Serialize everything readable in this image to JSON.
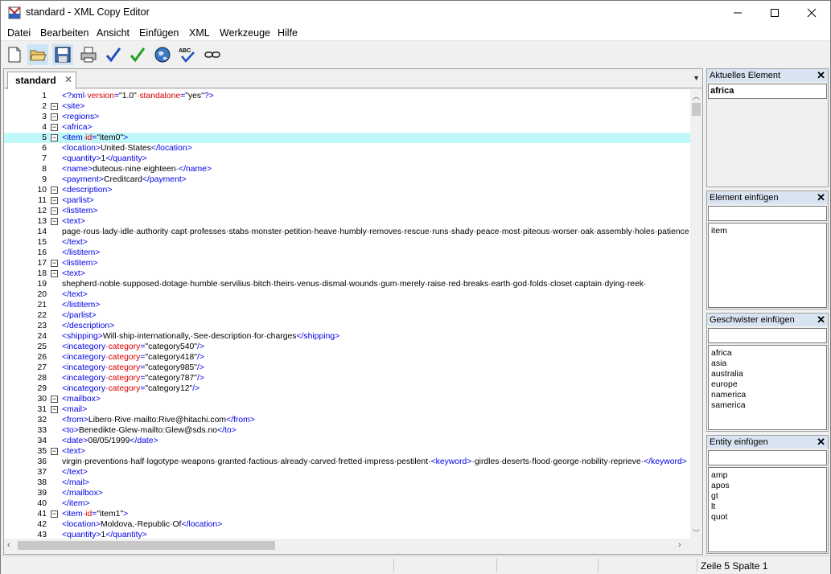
{
  "window": {
    "title": "standard - XML Copy Editor",
    "minimize_icon": "minimize-icon",
    "maximize_icon": "maximize-icon",
    "close_icon": "close-icon"
  },
  "menu": [
    "Datei",
    "Bearbeiten",
    "Ansicht",
    "Einfügen",
    "XML",
    "Werkzeuge",
    "Hilfe"
  ],
  "toolbar": [
    "new-file-icon",
    "open-folder-icon",
    "save-icon",
    "print-icon",
    "check-wellformed-icon",
    "validate-icon",
    "browser-icon",
    "spellcheck-icon",
    "link-icon"
  ],
  "tab": {
    "label": "standard",
    "close": "✕"
  },
  "editor": {
    "current_line": 5,
    "lines": [
      {
        "n": "1",
        "fold": false,
        "parts": [
          [
            "tag",
            "<?xml·"
          ],
          [
            "attr",
            "version"
          ],
          [
            "tag",
            "="
          ],
          [
            "txt",
            "\"1.0\""
          ],
          [
            "attr",
            "·standalone"
          ],
          [
            "tag",
            "="
          ],
          [
            "txt",
            "\"yes\""
          ],
          [
            "tag",
            "?>"
          ]
        ]
      },
      {
        "n": "2",
        "fold": true,
        "parts": [
          [
            "tag",
            "<site>"
          ]
        ]
      },
      {
        "n": "3",
        "fold": true,
        "parts": [
          [
            "tag",
            "<regions>"
          ]
        ]
      },
      {
        "n": "4",
        "fold": true,
        "parts": [
          [
            "tag",
            "<africa>"
          ]
        ]
      },
      {
        "n": "5",
        "fold": true,
        "parts": [
          [
            "tag",
            "<item"
          ],
          [
            "attr",
            "·id"
          ],
          [
            "tag",
            "="
          ],
          [
            "txt",
            "\"item0\""
          ],
          [
            "tag",
            ">"
          ]
        ]
      },
      {
        "n": "6",
        "fold": false,
        "parts": [
          [
            "tag",
            "<location>"
          ],
          [
            "txt",
            "United·States"
          ],
          [
            "tag",
            "</location>"
          ]
        ]
      },
      {
        "n": "7",
        "fold": false,
        "parts": [
          [
            "tag",
            "<quantity>"
          ],
          [
            "txt",
            "1"
          ],
          [
            "tag",
            "</quantity>"
          ]
        ]
      },
      {
        "n": "8",
        "fold": false,
        "parts": [
          [
            "tag",
            "<name>"
          ],
          [
            "txt",
            "duteous·nine·eighteen·"
          ],
          [
            "tag",
            "</name>"
          ]
        ]
      },
      {
        "n": "9",
        "fold": false,
        "parts": [
          [
            "tag",
            "<payment>"
          ],
          [
            "txt",
            "Creditcard"
          ],
          [
            "tag",
            "</payment>"
          ]
        ]
      },
      {
        "n": "10",
        "fold": true,
        "parts": [
          [
            "tag",
            "<description>"
          ]
        ]
      },
      {
        "n": "11",
        "fold": true,
        "parts": [
          [
            "tag",
            "<parlist>"
          ]
        ]
      },
      {
        "n": "12",
        "fold": true,
        "parts": [
          [
            "tag",
            "<listitem>"
          ]
        ]
      },
      {
        "n": "13",
        "fold": true,
        "parts": [
          [
            "tag",
            "<text>"
          ]
        ]
      },
      {
        "n": "14",
        "fold": false,
        "parts": [
          [
            "txt",
            "page·rous·lady·idle·authority·capt·professes·stabs·monster·petition·heave·humbly·removes·rescue·runs·shady·peace·most·piteous·worser·oak·assembly·holes·patience"
          ]
        ]
      },
      {
        "n": "15",
        "fold": false,
        "parts": [
          [
            "tag",
            "</text>"
          ]
        ]
      },
      {
        "n": "16",
        "fold": false,
        "parts": [
          [
            "tag",
            "</listitem>"
          ]
        ]
      },
      {
        "n": "17",
        "fold": true,
        "parts": [
          [
            "tag",
            "<listitem>"
          ]
        ]
      },
      {
        "n": "18",
        "fold": true,
        "parts": [
          [
            "tag",
            "<text>"
          ]
        ]
      },
      {
        "n": "19",
        "fold": false,
        "parts": [
          [
            "txt",
            "shepherd·noble·supposed·dotage·humble·servilius·bitch·theirs·venus·dismal·wounds·gum·merely·raise·red·breaks·earth·god·folds·closet·captain·dying·reek·"
          ]
        ]
      },
      {
        "n": "20",
        "fold": false,
        "parts": [
          [
            "tag",
            "</text>"
          ]
        ]
      },
      {
        "n": "21",
        "fold": false,
        "parts": [
          [
            "tag",
            "</listitem>"
          ]
        ]
      },
      {
        "n": "22",
        "fold": false,
        "parts": [
          [
            "tag",
            "</parlist>"
          ]
        ]
      },
      {
        "n": "23",
        "fold": false,
        "parts": [
          [
            "tag",
            "</description>"
          ]
        ]
      },
      {
        "n": "24",
        "fold": false,
        "parts": [
          [
            "tag",
            "<shipping>"
          ],
          [
            "txt",
            "Will·ship·internationally,·See·description·for·charges"
          ],
          [
            "tag",
            "</shipping>"
          ]
        ]
      },
      {
        "n": "25",
        "fold": false,
        "parts": [
          [
            "tag",
            "<incategory"
          ],
          [
            "attr",
            "·category"
          ],
          [
            "tag",
            "="
          ],
          [
            "txt",
            "\"category540\""
          ],
          [
            "tag",
            "/>"
          ]
        ]
      },
      {
        "n": "26",
        "fold": false,
        "parts": [
          [
            "tag",
            "<incategory"
          ],
          [
            "attr",
            "·category"
          ],
          [
            "tag",
            "="
          ],
          [
            "txt",
            "\"category418\""
          ],
          [
            "tag",
            "/>"
          ]
        ]
      },
      {
        "n": "27",
        "fold": false,
        "parts": [
          [
            "tag",
            "<incategory"
          ],
          [
            "attr",
            "·category"
          ],
          [
            "tag",
            "="
          ],
          [
            "txt",
            "\"category985\""
          ],
          [
            "tag",
            "/>"
          ]
        ]
      },
      {
        "n": "28",
        "fold": false,
        "parts": [
          [
            "tag",
            "<incategory"
          ],
          [
            "attr",
            "·category"
          ],
          [
            "tag",
            "="
          ],
          [
            "txt",
            "\"category787\""
          ],
          [
            "tag",
            "/>"
          ]
        ]
      },
      {
        "n": "29",
        "fold": false,
        "parts": [
          [
            "tag",
            "<incategory"
          ],
          [
            "attr",
            "·category"
          ],
          [
            "tag",
            "="
          ],
          [
            "txt",
            "\"category12\""
          ],
          [
            "tag",
            "/>"
          ]
        ]
      },
      {
        "n": "30",
        "fold": true,
        "parts": [
          [
            "tag",
            "<mailbox>"
          ]
        ]
      },
      {
        "n": "31",
        "fold": true,
        "parts": [
          [
            "tag",
            "<mail>"
          ]
        ]
      },
      {
        "n": "32",
        "fold": false,
        "parts": [
          [
            "tag",
            "<from>"
          ],
          [
            "txt",
            "Libero·Rive·mailto:Rive@hitachi.com"
          ],
          [
            "tag",
            "</from>"
          ]
        ]
      },
      {
        "n": "33",
        "fold": false,
        "parts": [
          [
            "tag",
            "<to>"
          ],
          [
            "txt",
            "Benedikte·Glew·mailto:Glew@sds.no"
          ],
          [
            "tag",
            "</to>"
          ]
        ]
      },
      {
        "n": "34",
        "fold": false,
        "parts": [
          [
            "tag",
            "<date>"
          ],
          [
            "txt",
            "08/05/1999"
          ],
          [
            "tag",
            "</date>"
          ]
        ]
      },
      {
        "n": "35",
        "fold": true,
        "parts": [
          [
            "tag",
            "<text>"
          ]
        ]
      },
      {
        "n": "36",
        "fold": false,
        "parts": [
          [
            "txt",
            "virgin·preventions·half·logotype·weapons·granted·factious·already·carved·fretted·impress·pestilent·"
          ],
          [
            "tag",
            "<keyword>"
          ],
          [
            "txt",
            "·girdles·deserts·flood·george·nobility·reprieve·"
          ],
          [
            "tag",
            "</keyword>"
          ]
        ]
      },
      {
        "n": "37",
        "fold": false,
        "parts": [
          [
            "tag",
            "</text>"
          ]
        ]
      },
      {
        "n": "38",
        "fold": false,
        "parts": [
          [
            "tag",
            "</mail>"
          ]
        ]
      },
      {
        "n": "39",
        "fold": false,
        "parts": [
          [
            "tag",
            "</mailbox>"
          ]
        ]
      },
      {
        "n": "40",
        "fold": false,
        "parts": [
          [
            "tag",
            "</item>"
          ]
        ]
      },
      {
        "n": "41",
        "fold": true,
        "parts": [
          [
            "tag",
            "<item"
          ],
          [
            "attr",
            "·id"
          ],
          [
            "tag",
            "="
          ],
          [
            "txt",
            "\"item1\""
          ],
          [
            "tag",
            ">"
          ]
        ]
      },
      {
        "n": "42",
        "fold": false,
        "parts": [
          [
            "tag",
            "<location>"
          ],
          [
            "txt",
            "Moldova,·Republic·Of"
          ],
          [
            "tag",
            "</location>"
          ]
        ]
      },
      {
        "n": "43",
        "fold": false,
        "parts": [
          [
            "tag",
            "<quantity>"
          ],
          [
            "txt",
            "1"
          ],
          [
            "tag",
            "</quantity>"
          ]
        ]
      }
    ]
  },
  "panels": {
    "current": {
      "title": "Aktuelles Element",
      "value": "africa"
    },
    "insert_element": {
      "title": "Element einfügen",
      "items": [
        "item"
      ]
    },
    "insert_sibling": {
      "title": "Geschwister einfügen",
      "items": [
        "africa",
        "asia",
        "australia",
        "europe",
        "namerica",
        "samerica"
      ]
    },
    "insert_entity": {
      "title": "Entity einfügen",
      "items": [
        "amp",
        "apos",
        "gt",
        "lt",
        "quot"
      ]
    }
  },
  "status": {
    "position": "Zeile 5 Spalte 1"
  }
}
